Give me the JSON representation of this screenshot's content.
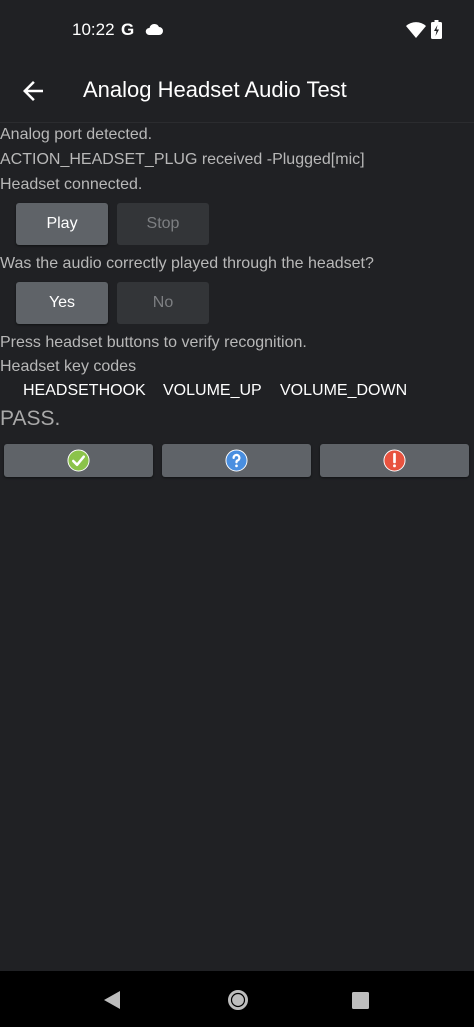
{
  "status_bar": {
    "time": "10:22",
    "g_glyph": "G",
    "icons": [
      "google-g-icon",
      "cloud-icon",
      "wifi-icon",
      "battery-icon"
    ]
  },
  "app_bar": {
    "title": "Analog Headset Audio Test",
    "back_icon": "arrow-back-icon"
  },
  "content": {
    "line1": "Analog port detected.",
    "line2": "ACTION_HEADSET_PLUG received -Plugged[mic]",
    "line3": "Headset connected.",
    "play_label": "Play",
    "stop_label": "Stop",
    "question": "Was the audio correctly played through the headset?",
    "yes_label": "Yes",
    "no_label": "No",
    "press_instruction": "Press headset buttons to verify recognition.",
    "keycodes_heading": "Headset key codes",
    "keycodes": [
      "HEADSETHOOK",
      "VOLUME_UP",
      "VOLUME_DOWN"
    ],
    "result_label": "PASS."
  },
  "result_buttons": [
    {
      "icon": "pass-check-icon",
      "color": "#8bc34a"
    },
    {
      "icon": "info-question-icon",
      "color": "#4a8fe0"
    },
    {
      "icon": "fail-exclamation-icon",
      "color": "#e8533f"
    }
  ],
  "colors": {
    "background": "#202124",
    "button_enabled": "#5f6368",
    "button_disabled": "#333538"
  },
  "nav_bar": {
    "icons": [
      "nav-back-icon",
      "nav-home-icon",
      "nav-recents-icon"
    ]
  }
}
